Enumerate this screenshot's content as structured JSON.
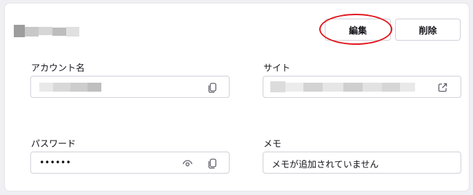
{
  "header": {
    "edit_label": "編集",
    "delete_label": "削除"
  },
  "fields": {
    "account_label": "アカウント名",
    "site_label": "サイト",
    "password_label": "パスワード",
    "password_value": "••••••",
    "memo_label": "メモ",
    "memo_value": "メモが追加されていません"
  },
  "icons": {
    "copy": "copy-icon",
    "external": "external-link-icon",
    "reveal": "eye-icon"
  },
  "colors": {
    "highlight_ring": "#e0141a",
    "border": "#cfcfd8"
  }
}
